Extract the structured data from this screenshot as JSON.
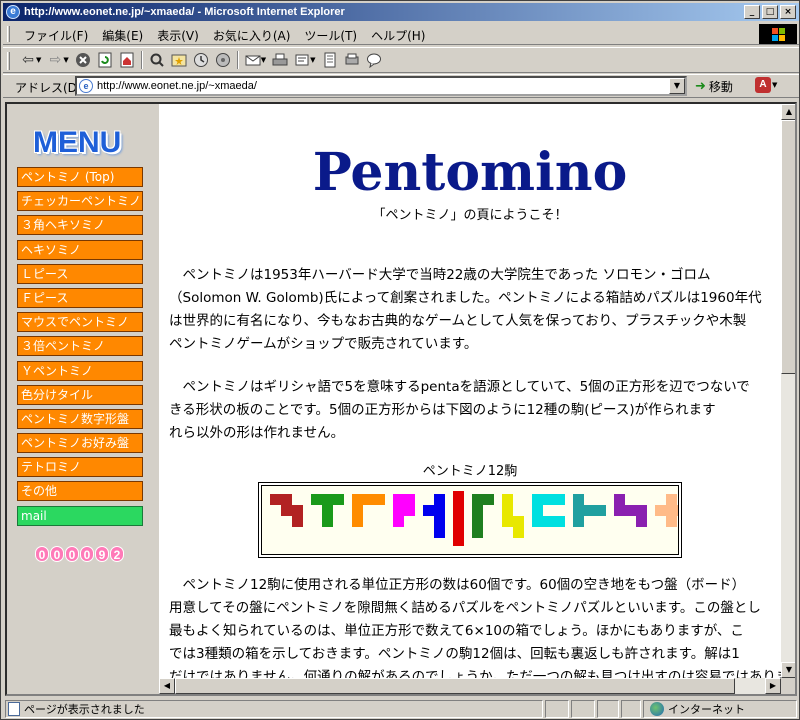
{
  "window": {
    "title": "http://www.eonet.ne.jp/~xmaeda/ - Microsoft Internet Explorer",
    "buttons": [
      "_",
      "□",
      "×"
    ]
  },
  "menubar": [
    "ファイル(F)",
    "編集(E)",
    "表示(V)",
    "お気に入り(A)",
    "ツール(T)",
    "ヘルプ(H)"
  ],
  "toolbar": {
    "icons": [
      "back-icon",
      "forward-icon",
      "stop-icon",
      "refresh-icon",
      "home-icon",
      "search-icon",
      "favorites-icon",
      "history-icon",
      "mail-icon",
      "print-icon",
      "edit-icon",
      "discuss-icon",
      "messenger-icon"
    ]
  },
  "address": {
    "label": "アドレス(D)",
    "url": "http://www.eonet.ne.jp/~xmaeda/",
    "go_label": "移動"
  },
  "sidebar": {
    "menu_title": "MENU",
    "items": [
      "ペントミノ (Top)",
      "チェッカーペントミノ",
      "３角ヘキソミノ",
      "ヘキソミノ",
      "Ｌピース",
      "Ｆピース",
      "マウスでペントミノ",
      "３倍ペントミノ",
      "Ｙペントミノ",
      "色分けタイル",
      "ペントミノ数字形盤",
      "ペントミノお好み盤",
      "テトロミノ",
      "その他"
    ],
    "mail_label": "mail",
    "counter": [
      "0",
      "0",
      "0",
      "0",
      "9",
      "2"
    ]
  },
  "content": {
    "title": "Pentomino",
    "welcome": "「ペントミノ」の頁にようこそ！",
    "para1": [
      "　ペントミノは1953年ハーバード大学で当時22歳の大学院生であった ソロモン・ゴロム",
      "（Solomon W. Golomb)氏によって創案されました。ペントミノによる箱詰めパズルは1960年代",
      "は世界的に有名になり、今もなお古典的なゲームとして人気を保っており、プラスチックや木製",
      "ペントミノゲームがショップで販売されています。"
    ],
    "para2": [
      "　ペントミノはギリシャ語で5を意味するpentaを語源としていて、5個の正方形を辺でつないで",
      "きる形状の板のことです。5個の正方形からは下図のように12種の駒(ピース)が作られます",
      "れら以外の形は作れません。"
    ],
    "caption": "ペントミノ12駒",
    "para3": [
      "　ペントミノ12駒に使用される単位正方形の数は60個です。60個の空き地をもつ盤（ボード）",
      "用意してその盤にペントミノを隙間無く詰めるパズルをペントミノパズルといいます。この盤とし",
      "最もよく知られているのは、単位正方形で数えて6×10の箱でしょう。ほかにもありますが、こ",
      "では3種類の箱を示しておきます。ペントミノの駒12個は、回転も裏返しも許されます。解は1",
      "だけではありません。何通りの解があるのでしょうか。ただ一つの解も見つけ出すのは容易ではありま"
    ]
  },
  "pieces": [
    {
      "name": "W-pentomino",
      "color": "#b22222",
      "cells": [
        [
          0,
          0
        ],
        [
          1,
          0
        ],
        [
          1,
          1
        ],
        [
          2,
          1
        ],
        [
          2,
          2
        ]
      ]
    },
    {
      "name": "X-pentomino-green",
      "color": "#1a9a1a",
      "cells": [
        [
          0,
          0
        ],
        [
          1,
          0
        ],
        [
          2,
          0
        ],
        [
          1,
          1
        ],
        [
          1,
          2
        ]
      ]
    },
    {
      "name": "V-pentomino",
      "color": "#ff8c00",
      "cells": [
        [
          0,
          0
        ],
        [
          1,
          0
        ],
        [
          2,
          0
        ],
        [
          0,
          1
        ],
        [
          0,
          2
        ]
      ]
    },
    {
      "name": "P-pentomino",
      "color": "#ff00ff",
      "cells": [
        [
          0,
          0
        ],
        [
          1,
          0
        ],
        [
          0,
          1
        ],
        [
          1,
          1
        ],
        [
          0,
          2
        ]
      ]
    },
    {
      "name": "Y-pentomino",
      "color": "#0000ee",
      "cells": [
        [
          1,
          0
        ],
        [
          1,
          1
        ],
        [
          0,
          1
        ],
        [
          1,
          2
        ],
        [
          1,
          3
        ]
      ]
    },
    {
      "name": "I-pentomino",
      "color": "#e00000",
      "cells": [
        [
          0,
          0
        ],
        [
          0,
          1
        ],
        [
          0,
          2
        ],
        [
          0,
          3
        ],
        [
          0,
          4
        ]
      ]
    },
    {
      "name": "L-pentomino",
      "color": "#1f7f1f",
      "cells": [
        [
          0,
          0
        ],
        [
          1,
          0
        ],
        [
          0,
          1
        ],
        [
          0,
          2
        ],
        [
          0,
          3
        ]
      ]
    },
    {
      "name": "N-pentomino",
      "color": "#e8e800",
      "cells": [
        [
          0,
          0
        ],
        [
          0,
          1
        ],
        [
          0,
          2
        ],
        [
          1,
          2
        ],
        [
          1,
          3
        ]
      ]
    },
    {
      "name": "U-pentomino",
      "color": "#00e0e0",
      "cells": [
        [
          0,
          0
        ],
        [
          1,
          0
        ],
        [
          2,
          0
        ],
        [
          0,
          1
        ],
        [
          0,
          2
        ],
        [
          1,
          2
        ],
        [
          2,
          2
        ]
      ]
    },
    {
      "name": "T-pentomino",
      "color": "#20a0a0",
      "cells": [
        [
          0,
          0
        ],
        [
          0,
          1
        ],
        [
          1,
          1
        ],
        [
          2,
          1
        ],
        [
          0,
          2
        ]
      ]
    },
    {
      "name": "Z-pentomino",
      "color": "#8a20b0",
      "cells": [
        [
          0,
          0
        ],
        [
          0,
          1
        ],
        [
          1,
          1
        ],
        [
          2,
          1
        ],
        [
          2,
          2
        ]
      ]
    },
    {
      "name": "plus-pentomino",
      "color": "#ffbb88",
      "cells": [
        [
          1,
          0
        ],
        [
          0,
          1
        ],
        [
          1,
          1
        ],
        [
          2,
          1
        ],
        [
          1,
          2
        ]
      ]
    }
  ],
  "status": {
    "text": "ページが表示されました",
    "zone": "インターネット"
  },
  "colors": {
    "nav_bg": "#ff8800",
    "mail_bg": "#2bd860",
    "title_color": "#0a1a8a"
  }
}
